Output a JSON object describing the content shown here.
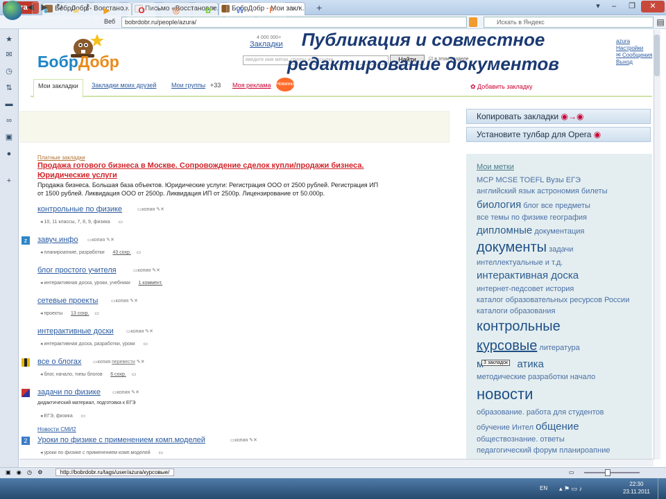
{
  "browser": {
    "menu_label": "Opera",
    "tabs": [
      {
        "label": "БобрДобр - Восстано..."
      },
      {
        "label": "Письмо «Восстановле..."
      },
      {
        "label": "БобрДобр - Мои закл..."
      }
    ],
    "new_tab": "+",
    "address": "bobrdobr.ru/people/azura/",
    "address_prefix": "Веб",
    "search_placeholder": "Искать в Яндекс",
    "status_url": "http://bobrdobr.ru/tags/user/azura/курсовые/"
  },
  "overlay_title": [
    "Публикация и совместное",
    "редактирование  документов"
  ],
  "site": {
    "logo_main": "Бобр",
    "logo_accent": "Добр",
    "bookmarks_count": "4 000 000+",
    "bookmarks_link": "Закладки",
    "search_placeholder": "введите имя метки, группы или ссылки",
    "find_button": "Найти",
    "in_section": "в этом разделе",
    "user_links": [
      "azura",
      "Настройки",
      "Сообщения",
      "Выход"
    ],
    "tabs": [
      {
        "label": "Мои закладки"
      },
      {
        "label": "Закладки моих друзей"
      },
      {
        "label": "Мои группы"
      },
      {
        "label": "Моя реклама"
      }
    ],
    "groups_count": "+33",
    "new_badge": "Новинка!",
    "add_bookmark": "Добавить закладку"
  },
  "right": {
    "copy_bookmarks": "Копировать закладки",
    "install_toolbar": "Установите тулбар для Opera",
    "my_tags_title": "Мои метки",
    "tooltip": "3 закладок"
  },
  "tags": [
    {
      "text": "МСР"
    },
    {
      "text": "MCSE"
    },
    {
      "text": "TOEFL"
    },
    {
      "text": "Вузы"
    },
    {
      "text": "ЕГЭ"
    },
    {
      "text": "английский язык"
    },
    {
      "text": "астрономия"
    },
    {
      "text": "билеты"
    },
    {
      "text": "биология"
    },
    {
      "text": "блог"
    },
    {
      "text": "все предметы"
    },
    {
      "text": "все темы по физике"
    },
    {
      "text": "география"
    },
    {
      "text": "дипломные"
    },
    {
      "text": "документация"
    },
    {
      "text": "документы"
    },
    {
      "text": "задачи"
    },
    {
      "text": "интеллектуальные и т.д."
    },
    {
      "text": "интерактивная доска"
    },
    {
      "text": "интернет-педсовет"
    },
    {
      "text": "история"
    },
    {
      "text": "каталог образовательных ресурсов России"
    },
    {
      "text": "каталоги образования"
    },
    {
      "text": "контрольные"
    },
    {
      "text": "курсовые"
    },
    {
      "text": "литература"
    },
    {
      "text": "м"
    },
    {
      "text": "атика"
    },
    {
      "text": "методические разработки"
    },
    {
      "text": "начало"
    },
    {
      "text": "новости"
    },
    {
      "text": "образование."
    },
    {
      "text": "работа для студентов"
    },
    {
      "text": "обучение"
    },
    {
      "text": "Интел"
    },
    {
      "text": "общение"
    },
    {
      "text": "обществознание."
    },
    {
      "text": "ответы"
    },
    {
      "text": "педагогический форум"
    },
    {
      "text": "планироапние"
    }
  ],
  "ad": {
    "label": "Платные закладки",
    "title_line1": "Продажа готового бизнеса в Москве. Сопровождение сделок купли/продажи бизнеса.",
    "title_line2": "Юридические услуги",
    "text_line1": "Продажа бизнеса. Большая база объектов. Юридические услуги: Регистрация ООО от 2500 рублей. Регистрация ИП",
    "text_line2": "от 1500 рублей. Ликвидация ООО от 2500р. Ликвидация ИП от 2500р. Лицензирование от 50.000р."
  },
  "bookmarks": [
    {
      "title": "контрольные по физике",
      "copy": "копия",
      "meta": "10, 11 классы, 7, 8, 9, физика",
      "extra": ""
    },
    {
      "title": "завуч.инфо",
      "copy": "копия",
      "meta": "планироапние, разработки",
      "extra": "43 сохр."
    },
    {
      "title": "блог простого учителя",
      "copy": "копия",
      "meta": "интерактивная доска, уроки, учебники",
      "extra": "1 коммент."
    },
    {
      "title": "сетевые проекты",
      "copy": "копия",
      "meta": "проекты",
      "extra": "13 сохр."
    },
    {
      "title": "интерактивные доски",
      "copy": "копия",
      "meta": "интерактивная доска, разработки, уроки",
      "extra": ""
    },
    {
      "title": "все о блогах",
      "copy": "копия",
      "copy2": "перевести",
      "meta": "блог, начало, типы блогов",
      "extra": "6 сохр."
    },
    {
      "title": "задачи по физике",
      "copy": "копия",
      "desc": "дидактический материал, подготовка к ЕГЭ",
      "meta": "ЕГЭ, физика",
      "extra": ""
    },
    {
      "group": "Новости СМИ2",
      "title": "Уроки по физике с применением комп.моделей",
      "copy": "копия",
      "meta": "уроки по физике с применением комп.моделей",
      "extra": ""
    }
  ],
  "taskbar": {
    "lang": "EN",
    "time": "22:30",
    "date": "23.11.2011"
  }
}
